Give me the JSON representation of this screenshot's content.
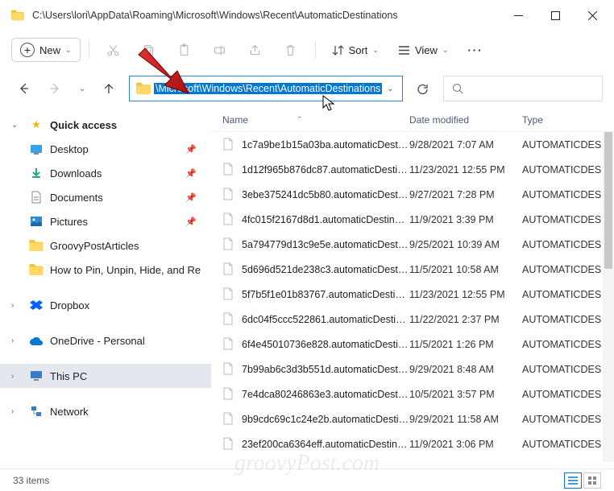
{
  "title": "C:\\Users\\lori\\AppData\\Roaming\\Microsoft\\Windows\\Recent\\AutomaticDestinations",
  "toolbar": {
    "new": "New",
    "sort": "Sort",
    "view": "View"
  },
  "address_selected": "\\Microsoft\\Windows\\Recent\\AutomaticDestinations",
  "sidebar": {
    "quick": "Quick access",
    "items": [
      {
        "label": "Desktop"
      },
      {
        "label": "Downloads"
      },
      {
        "label": "Documents"
      },
      {
        "label": "Pictures"
      },
      {
        "label": "GroovyPostArticles"
      },
      {
        "label": "How to Pin, Unpin, Hide, and Re"
      }
    ],
    "dropbox": "Dropbox",
    "onedrive": "OneDrive - Personal",
    "thispc": "This PC",
    "network": "Network"
  },
  "columns": {
    "name": "Name",
    "date": "Date modified",
    "type": "Type"
  },
  "files": [
    {
      "name": "1c7a9be1b15a03ba.automaticDestinatio…",
      "date": "9/28/2021 7:07 AM",
      "type": "AUTOMATICDES"
    },
    {
      "name": "1d12f965b876dc87.automaticDestinatio…",
      "date": "11/23/2021 12:55 PM",
      "type": "AUTOMATICDES"
    },
    {
      "name": "3ebe375241dc5b80.automaticDestinatio…",
      "date": "9/27/2021 7:28 PM",
      "type": "AUTOMATICDES"
    },
    {
      "name": "4fc015f2167d8d1.automaticDestinations-…",
      "date": "11/9/2021 3:39 PM",
      "type": "AUTOMATICDES"
    },
    {
      "name": "5a794779d13c9e5e.automaticDestinatio…",
      "date": "9/25/2021 10:39 AM",
      "type": "AUTOMATICDES"
    },
    {
      "name": "5d696d521de238c3.automaticDestinatio…",
      "date": "11/5/2021 10:58 AM",
      "type": "AUTOMATICDES"
    },
    {
      "name": "5f7b5f1e01b83767.automaticDestination…",
      "date": "11/23/2021 12:55 PM",
      "type": "AUTOMATICDES"
    },
    {
      "name": "6dc04f5ccc522861.automaticDestinatio…",
      "date": "11/22/2021 2:37 PM",
      "type": "AUTOMATICDES"
    },
    {
      "name": "6f4e45010736e828.automaticDestinatio…",
      "date": "11/5/2021 1:26 PM",
      "type": "AUTOMATICDES"
    },
    {
      "name": "7b99ab6c3d3b551d.automaticDestinatio…",
      "date": "9/29/2021 8:48 AM",
      "type": "AUTOMATICDES"
    },
    {
      "name": "7e4dca80246863e3.automaticDestinatio…",
      "date": "10/5/2021 3:57 PM",
      "type": "AUTOMATICDES"
    },
    {
      "name": "9b9cdc69c1c24e2b.automaticDestinatio…",
      "date": "9/29/2021 11:58 AM",
      "type": "AUTOMATICDES"
    },
    {
      "name": "23ef200ca6364eff.automaticDestinations-…",
      "date": "11/9/2021 3:06 PM",
      "type": "AUTOMATICDES"
    }
  ],
  "status": "33 items",
  "watermark": "groovyPost.com"
}
